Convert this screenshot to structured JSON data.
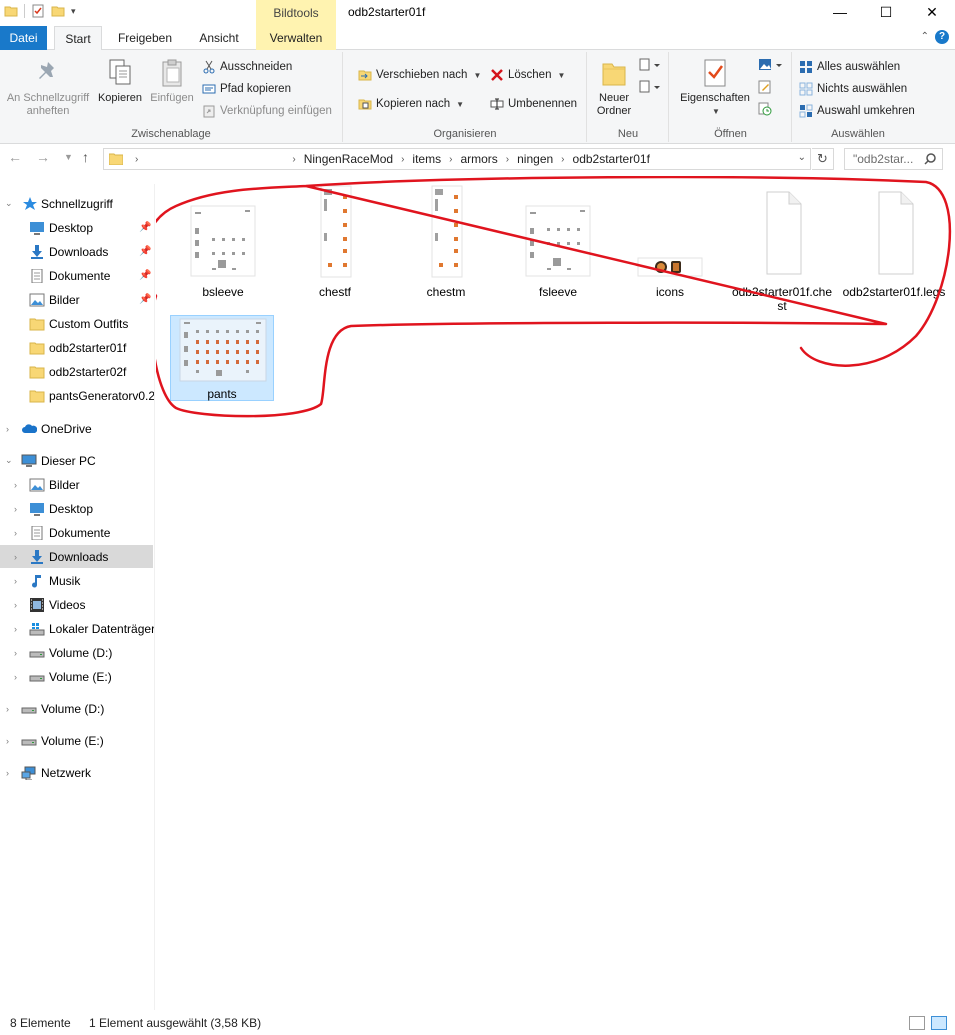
{
  "window": {
    "title": "odb2starter01f",
    "context_tab_header": "Bildtools",
    "controls": {
      "minimize": "—",
      "maximize": "☐",
      "close": "✕"
    }
  },
  "ribbon_tabs": [
    {
      "label": "Datei"
    },
    {
      "label": "Start"
    },
    {
      "label": "Freigeben"
    },
    {
      "label": "Ansicht"
    },
    {
      "label": "Verwalten"
    }
  ],
  "ribbon": {
    "clipboard": {
      "pin_quick_access": "An Schnellzugriff\nanheften",
      "copy": "Kopieren",
      "paste": "Einfügen",
      "cut": "Ausschneiden",
      "copy_path": "Pfad kopieren",
      "paste_shortcut": "Verknüpfung einfügen",
      "label": "Zwischenablage"
    },
    "organize": {
      "move_to": "Verschieben nach",
      "copy_to": "Kopieren nach",
      "delete": "Löschen",
      "rename": "Umbenennen",
      "label": "Organisieren"
    },
    "new": {
      "new_folder": "Neuer\nOrdner",
      "label": "Neu"
    },
    "open": {
      "properties": "Eigenschaften",
      "label": "Öffnen"
    },
    "select": {
      "select_all": "Alles auswählen",
      "select_none": "Nichts auswählen",
      "invert": "Auswahl umkehren",
      "label": "Auswählen"
    }
  },
  "address": {
    "crumbs": [
      "NingenRaceMod",
      "items",
      "armors",
      "ningen",
      "odb2starter01f"
    ],
    "search_placeholder": "\"odb2star..."
  },
  "nav_pane": {
    "quick_access": "Schnellzugriff",
    "quick_items": [
      "Desktop",
      "Downloads",
      "Dokumente",
      "Bilder",
      "Custom Outfits",
      "odb2starter01f",
      "odb2starter02f",
      "pantsGeneratorv0.2"
    ],
    "onedrive": "OneDrive",
    "this_pc": "Dieser PC",
    "pc_items": [
      "Bilder",
      "Desktop",
      "Dokumente",
      "Downloads",
      "Musik",
      "Videos",
      "Lokaler Datenträger",
      "Volume (D:)",
      "Volume (E:)"
    ],
    "volume_d": "Volume (D:)",
    "volume_e": "Volume (E:)",
    "network": "Netzwerk"
  },
  "files": [
    {
      "name": "bsleeve",
      "kind": "sheet-wide"
    },
    {
      "name": "chestf",
      "kind": "sheet-tall"
    },
    {
      "name": "chestm",
      "kind": "sheet-tall"
    },
    {
      "name": "fsleeve",
      "kind": "sheet-wide"
    },
    {
      "name": "icons",
      "kind": "icons"
    },
    {
      "name": "odb2starter01f.chest",
      "kind": "document"
    },
    {
      "name": "odb2starter01f.legs",
      "kind": "document"
    },
    {
      "name": "pants",
      "kind": "sheet-wide",
      "selected": true
    }
  ],
  "status": {
    "count": "8 Elemente",
    "selection": "1 Element ausgewählt (3,58 KB)"
  },
  "colors": {
    "file_tab": "#1979ca",
    "context_tab": "#fff3b0",
    "selection": "#cce8ff",
    "annotation": "#e0141e"
  }
}
